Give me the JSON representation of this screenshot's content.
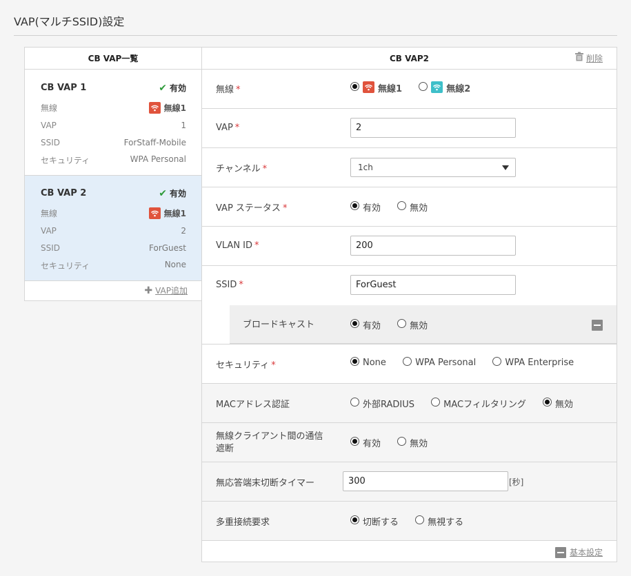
{
  "page": {
    "title": "VAP(マルチSSID)設定"
  },
  "list_panel": {
    "header": "CB VAP一覧",
    "cards": [
      {
        "name": "CB VAP 1",
        "status": "有効",
        "radio_label": "無線",
        "radio_value": "無線1",
        "vap_label": "VAP",
        "vap_value": "1",
        "ssid_label": "SSID",
        "ssid_value": "ForStaff-Mobile",
        "security_label": "セキュリティ",
        "security_value": "WPA Personal"
      },
      {
        "name": "CB VAP 2",
        "status": "有効",
        "radio_label": "無線",
        "radio_value": "無線1",
        "vap_label": "VAP",
        "vap_value": "2",
        "ssid_label": "SSID",
        "ssid_value": "ForGuest",
        "security_label": "セキュリティ",
        "security_value": "None"
      }
    ],
    "add_label": "VAP追加"
  },
  "detail": {
    "header": "CB VAP2",
    "delete_label": "削除",
    "radio": {
      "label": "無線",
      "options": [
        "無線1",
        "無線2"
      ],
      "selected": "無線1"
    },
    "vap": {
      "label": "VAP",
      "value": "2"
    },
    "channel": {
      "label": "チャンネル",
      "value": "1ch"
    },
    "vap_status": {
      "label": "VAP ステータス",
      "options": [
        "有効",
        "無効"
      ],
      "selected": "有効"
    },
    "vlan_id": {
      "label": "VLAN ID",
      "value": "200"
    },
    "ssid": {
      "label": "SSID",
      "value": "ForGuest"
    },
    "broadcast": {
      "label": "ブロードキャスト",
      "options": [
        "有効",
        "無効"
      ],
      "selected": "有効"
    },
    "security": {
      "label": "セキュリティ",
      "options": [
        "None",
        "WPA Personal",
        "WPA Enterprise"
      ],
      "selected": "None"
    },
    "mac_auth": {
      "label": "MACアドレス認証",
      "options": [
        "外部RADIUS",
        "MACフィルタリング",
        "無効"
      ],
      "selected": "無効"
    },
    "isolation": {
      "label": "無線クライアント間の通信遮断",
      "label_line1": "無線クライアント間の通信",
      "label_line2": "遮断",
      "options": [
        "有効",
        "無効"
      ],
      "selected": "有効"
    },
    "idle_timer": {
      "label": "無応答端末切断タイマー",
      "value": "300",
      "unit": "[秒]"
    },
    "multi_conn": {
      "label": "多重接続要求",
      "options": [
        "切断する",
        "無視する"
      ],
      "selected": "切断する"
    },
    "basic_settings_label": "基本設定"
  },
  "colors": {
    "accent_red": "#e0533c",
    "accent_teal": "#3ebfc9",
    "check_green": "#2e9a3a",
    "required": "#d9383a",
    "active_card": "#e3eef9"
  },
  "icons": [
    "wifi-icon",
    "check-icon",
    "trash-icon",
    "plus-icon",
    "minus-icon",
    "chevron-down-icon"
  ]
}
